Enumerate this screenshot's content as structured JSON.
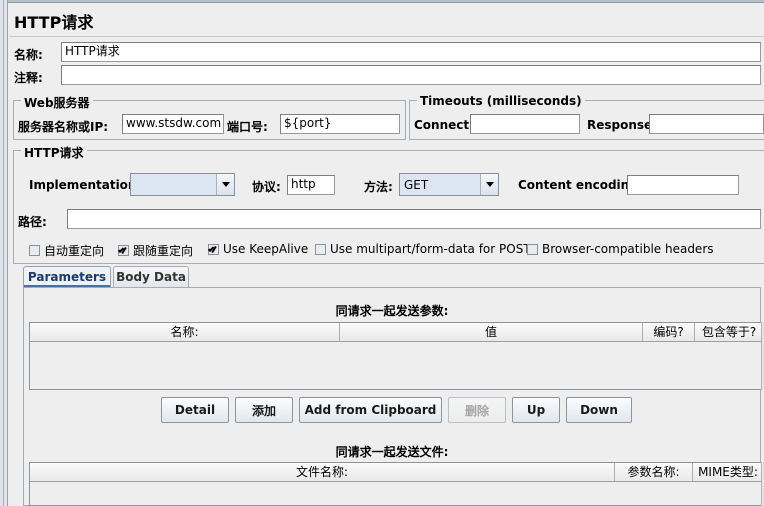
{
  "window": {
    "title": "HTTP请求"
  },
  "basic": {
    "name_label": "名称:",
    "name_value": "HTTP请求",
    "comment_label": "注释:",
    "comment_value": ""
  },
  "web_server": {
    "group_title": "Web服务器",
    "host_label": "服务器名称或IP:",
    "host_value": "www.stsdw.com",
    "port_label": "端口号:",
    "port_value": "${port}"
  },
  "timeouts": {
    "group_title": "Timeouts (milliseconds)",
    "connect_label": "Connect:",
    "connect_value": "",
    "response_label": "Response:",
    "response_value": ""
  },
  "http_request": {
    "group_title": "HTTP请求",
    "implementation_label": "Implementation:",
    "implementation_value": "",
    "protocol_label": "协议:",
    "protocol_value": "http",
    "method_label": "方法:",
    "method_value": "GET",
    "content_encoding_label": "Content encoding:",
    "content_encoding_value": "",
    "path_label": "路径:",
    "path_value": "",
    "checkboxes": [
      {
        "label": "自动重定向",
        "checked": false
      },
      {
        "label": "跟随重定向",
        "checked": true
      },
      {
        "label": "Use KeepAlive",
        "checked": true
      },
      {
        "label": "Use multipart/form-data for POST",
        "checked": false
      },
      {
        "label": "Browser-compatible headers",
        "checked": false
      }
    ]
  },
  "tabs": [
    {
      "label": "Parameters",
      "active": true
    },
    {
      "label": "Body Data",
      "active": false
    }
  ],
  "parameters": {
    "caption": "同请求一起发送参数:",
    "columns": [
      "名称:",
      "值",
      "编码?",
      "包含等于?"
    ],
    "rows": [],
    "buttons": [
      {
        "label": "Detail",
        "enabled": true
      },
      {
        "label": "添加",
        "enabled": true
      },
      {
        "label": "Add from Clipboard",
        "enabled": true
      },
      {
        "label": "删除",
        "enabled": false
      },
      {
        "label": "Up",
        "enabled": true
      },
      {
        "label": "Down",
        "enabled": true
      }
    ]
  },
  "files": {
    "caption": "同请求一起发送文件:",
    "columns": [
      "文件名称:",
      "参数名称:",
      "MIME类型:"
    ],
    "rows": []
  }
}
